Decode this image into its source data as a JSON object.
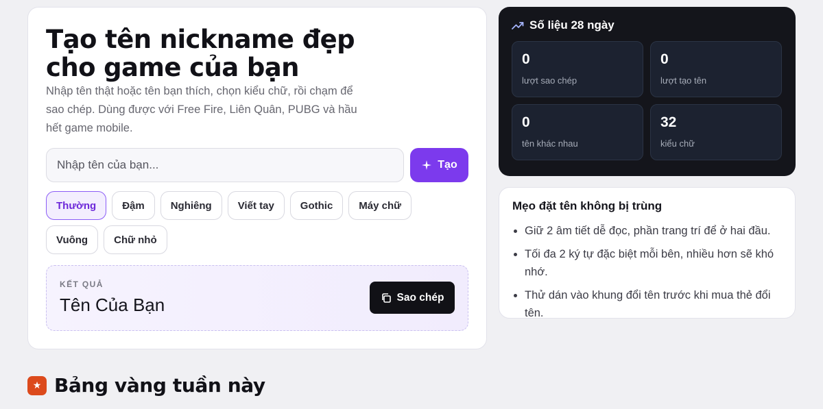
{
  "generator": {
    "title": "Tạo tên nickname đẹp\ncho game của bạn",
    "description": "Nhập tên thật hoặc tên bạn thích, chọn kiểu chữ, rồi chạm để sao chép. Dùng được với Free Fire, Liên Quân, PUBG và hầu hết game mobile.",
    "input_placeholder": "Nhập tên của bạn...",
    "input_value": "",
    "create_label": "Tạo",
    "styles": [
      "Thường",
      "Đậm",
      "Nghiêng",
      "Viết tay",
      "Gothic",
      "Máy chữ",
      "Vuông",
      "Chữ nhỏ"
    ],
    "active_style": "Thường",
    "result_label": "KẾT QUẢ",
    "result_value": "Tên Của Bạn",
    "copy_label": "Sao chép"
  },
  "stats": {
    "title": "Số liệu 28 ngày",
    "items": [
      {
        "value": "0",
        "label": "lượt sao chép"
      },
      {
        "value": "0",
        "label": "lượt tạo tên"
      },
      {
        "value": "0",
        "label": "tên khác nhau"
      },
      {
        "value": "32",
        "label": "kiểu chữ"
      }
    ]
  },
  "tips": {
    "title": "Mẹo đặt tên không bị trùng",
    "items": [
      "Giữ 2 âm tiết dễ đọc, phần trang trí để ở hai đầu.",
      "Tối đa 2 ký tự đặc biệt mỗi bên, nhiều hơn sẽ khó nhớ.",
      "Thử dán vào khung đổi tên trước khi mua thẻ đổi tên."
    ]
  },
  "leaderboard": {
    "title": "Bảng vàng tuần này",
    "icon": "star-icon"
  },
  "colors": {
    "accent": "#7c3aed",
    "stats_bg": "#14151b",
    "leader_icon": "#dc4a1c"
  }
}
